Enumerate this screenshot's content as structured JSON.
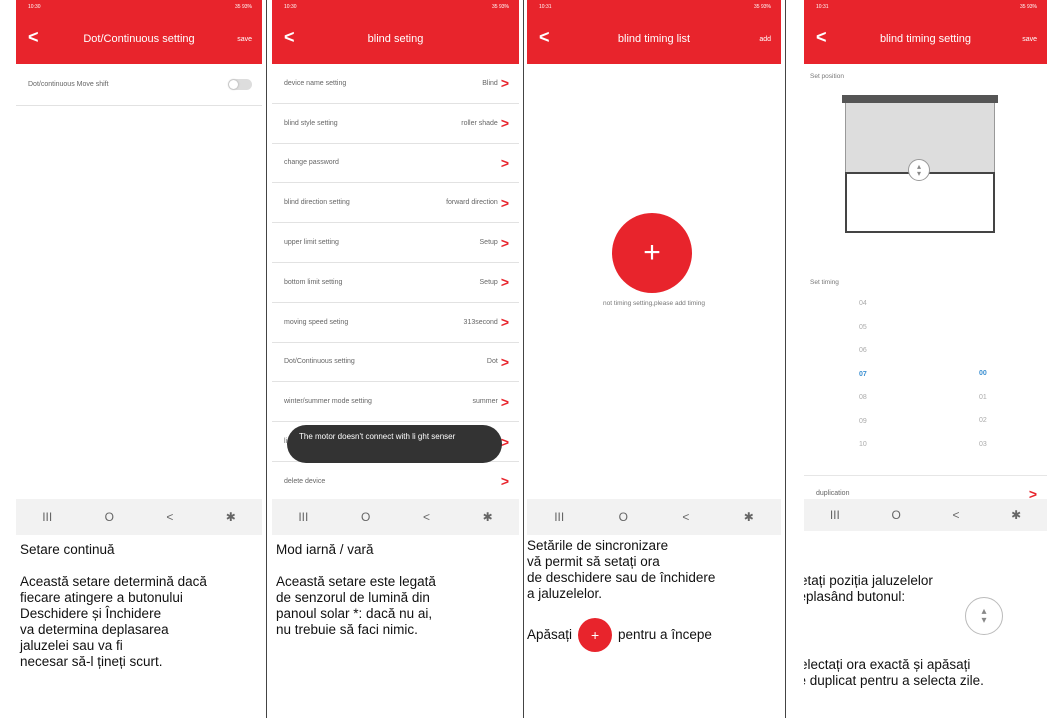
{
  "status": {
    "p1": {
      "time": "10:30",
      "right": "35 93%"
    },
    "p2": {
      "time": "10:30",
      "right": "35 93%"
    },
    "p3": {
      "time": "10:31",
      "right": "35 93%"
    },
    "p4": {
      "time": "10:31",
      "right": "35 93%"
    }
  },
  "panel1": {
    "title": "Dot/Continuous setting",
    "action": "save",
    "toggle_label": "Dot/continuous Move shift",
    "caption": [
      "Setare continuă",
      "",
      "Această setare determină dacă",
      "fiecare atingere a butonului",
      "Deschidere și Închidere",
      "va determina deplasarea",
      "jaluzelei sau va fi",
      " necesar să-l țineți scurt."
    ]
  },
  "panel2": {
    "title": "blind seting",
    "rows": [
      {
        "label": "device name setting",
        "value": "Blind"
      },
      {
        "label": "blind style setting",
        "value": "roller shade"
      },
      {
        "label": "change password",
        "value": ""
      },
      {
        "label": "blind direction setting",
        "value": "forward direction"
      },
      {
        "label": "upper limit setting",
        "value": "Setup"
      },
      {
        "label": "bottom limit setting",
        "value": "Setup"
      },
      {
        "label": "moving speed seting",
        "value": "313second"
      },
      {
        "label": "Dot/Continuous setting",
        "value": "Dot"
      },
      {
        "label": "winter/summer mode setting",
        "value": "summer"
      },
      {
        "label": "li",
        "value": ""
      },
      {
        "label": "delete device",
        "value": ""
      }
    ],
    "toast": "The motor doesn't connect with li ght senser",
    "caption": [
      "Mod iarnă / vară",
      "",
      "Această setare este legată",
      "de senzorul de lumină din",
      "panoul solar *: dacă nu ai,",
      "nu trebuie să faci nimic."
    ]
  },
  "panel3": {
    "title": "blind timing list",
    "action": "add",
    "empty": "not timing setting,please add timing",
    "caption": [
      "Setările de sincronizare",
      "vă permit să setați ora",
      "de deschidere sau de închidere",
      "a jaluzelelor."
    ],
    "press_prefix": "Apăsați",
    "press_suffix": "pentru a începe"
  },
  "panel4": {
    "title": "blind timing setting",
    "action": "save",
    "set_position": "Set position",
    "set_timing": "Set timing",
    "hours": [
      "04",
      "05",
      "06",
      "07",
      "08",
      "09",
      "10"
    ],
    "minutes": [
      "00",
      "01",
      "02",
      "03"
    ],
    "duplication": "duplication",
    "caption1": [
      "Setați poziția jaluzelelor",
      "deplasând butonul:"
    ],
    "caption2": [
      "Selectați ora exactă și apăsați",
      "pe duplicat pentru a selecta zile."
    ]
  },
  "nav": {
    "recent": "III",
    "home": "O",
    "back": "<",
    "access": "✱"
  }
}
